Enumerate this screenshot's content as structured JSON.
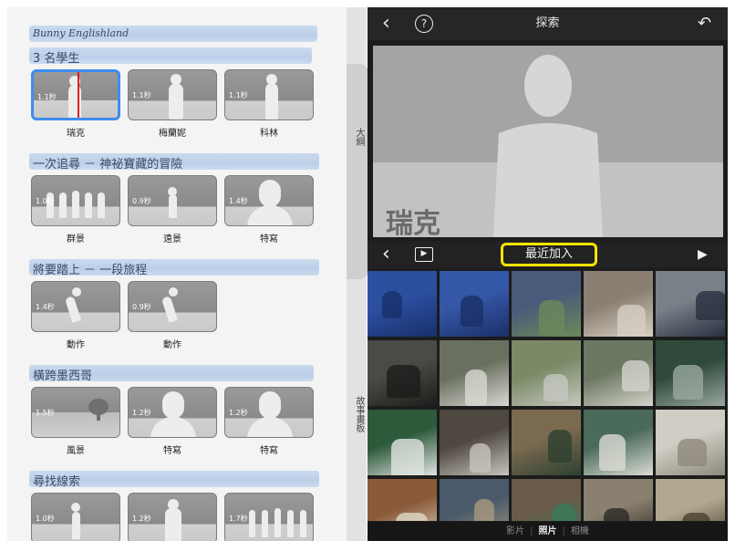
{
  "storyboard": {
    "brand": "Bunny Englishland",
    "sections": [
      {
        "title": "3 名學生",
        "clips": [
          {
            "duration": "1.1秒",
            "label": "瑞克",
            "selected": true
          },
          {
            "duration": "1.1秒",
            "label": "梅蘭妮",
            "selected": false
          },
          {
            "duration": "1.1秒",
            "label": "科林",
            "selected": false
          }
        ]
      },
      {
        "title": "一次追尋 － 神祕寶藏的冒險",
        "clips": [
          {
            "duration": "1.0秒",
            "label": "群景"
          },
          {
            "duration": "0.9秒",
            "label": "遠景"
          },
          {
            "duration": "1.4秒",
            "label": "特寫"
          }
        ]
      },
      {
        "title": "將要踏上 － 一段旅程",
        "clips": [
          {
            "duration": "1.4秒",
            "label": "動作"
          },
          {
            "duration": "0.9秒",
            "label": "動作"
          }
        ]
      },
      {
        "title": "橫跨墨西哥",
        "clips": [
          {
            "duration": "1.5秒",
            "label": "風景"
          },
          {
            "duration": "1.2秒",
            "label": "特寫"
          },
          {
            "duration": "1.2秒",
            "label": "特寫"
          }
        ]
      },
      {
        "title": "尋找線索",
        "clips": [
          {
            "duration": "1.0秒",
            "label": ""
          },
          {
            "duration": "1.2秒",
            "label": ""
          },
          {
            "duration": "1.7秒",
            "label": ""
          }
        ]
      }
    ]
  },
  "side_tabs": {
    "outline": "大綱",
    "storyboard": "故事畫板"
  },
  "topbar": {
    "title": "探索",
    "back_icon": "chevron-left-icon",
    "help_icon": "help-icon",
    "undo_icon": "undo-icon"
  },
  "preview": {
    "name": "瑞克"
  },
  "media_nav": {
    "album": "最近加入",
    "highlight_color": "#f5e400"
  },
  "photos": [
    {
      "bg": "#2c4fa0",
      "fg": "#18306a"
    },
    {
      "bg": "#3557a8",
      "fg": "#1a2f66"
    },
    {
      "bg": "#4a5a7a",
      "fg": "#6a8a5a"
    },
    {
      "bg": "#8a7f72",
      "fg": "#d8d0c4"
    },
    {
      "bg": "#7a8088",
      "fg": "#2a3040"
    },
    {
      "bg": "#4a4a46",
      "fg": "#1c1c1a"
    },
    {
      "bg": "#6a7060",
      "fg": "#d8dad2"
    },
    {
      "bg": "#7a8a66",
      "fg": "#c6c8c0"
    },
    {
      "bg": "#6c7862",
      "fg": "#d4d4cc"
    },
    {
      "bg": "#2f4a3a",
      "fg": "#9aa8a0"
    },
    {
      "bg": "#2e5a3c",
      "fg": "#e0e4e0"
    },
    {
      "bg": "#4e4840",
      "fg": "#c8c4bc"
    },
    {
      "bg": "#7a6a50",
      "fg": "#2e4030"
    },
    {
      "bg": "#4a6a5a",
      "fg": "#dcdcd4"
    },
    {
      "bg": "#cfcdc4",
      "fg": "#8e8a7c"
    },
    {
      "bg": "#8a5a3a",
      "fg": "#e0d8c8"
    },
    {
      "bg": "#4a5a6a",
      "fg": "#a89880"
    },
    {
      "bg": "#6a5a4a",
      "fg": "#3a7a5a"
    },
    {
      "bg": "#8a8070",
      "fg": "#2a2824"
    },
    {
      "bg": "#b0a890",
      "fg": "#4a4030"
    }
  ],
  "media_tabs": {
    "video": "影片",
    "photo": "照片",
    "camera": "相機"
  }
}
